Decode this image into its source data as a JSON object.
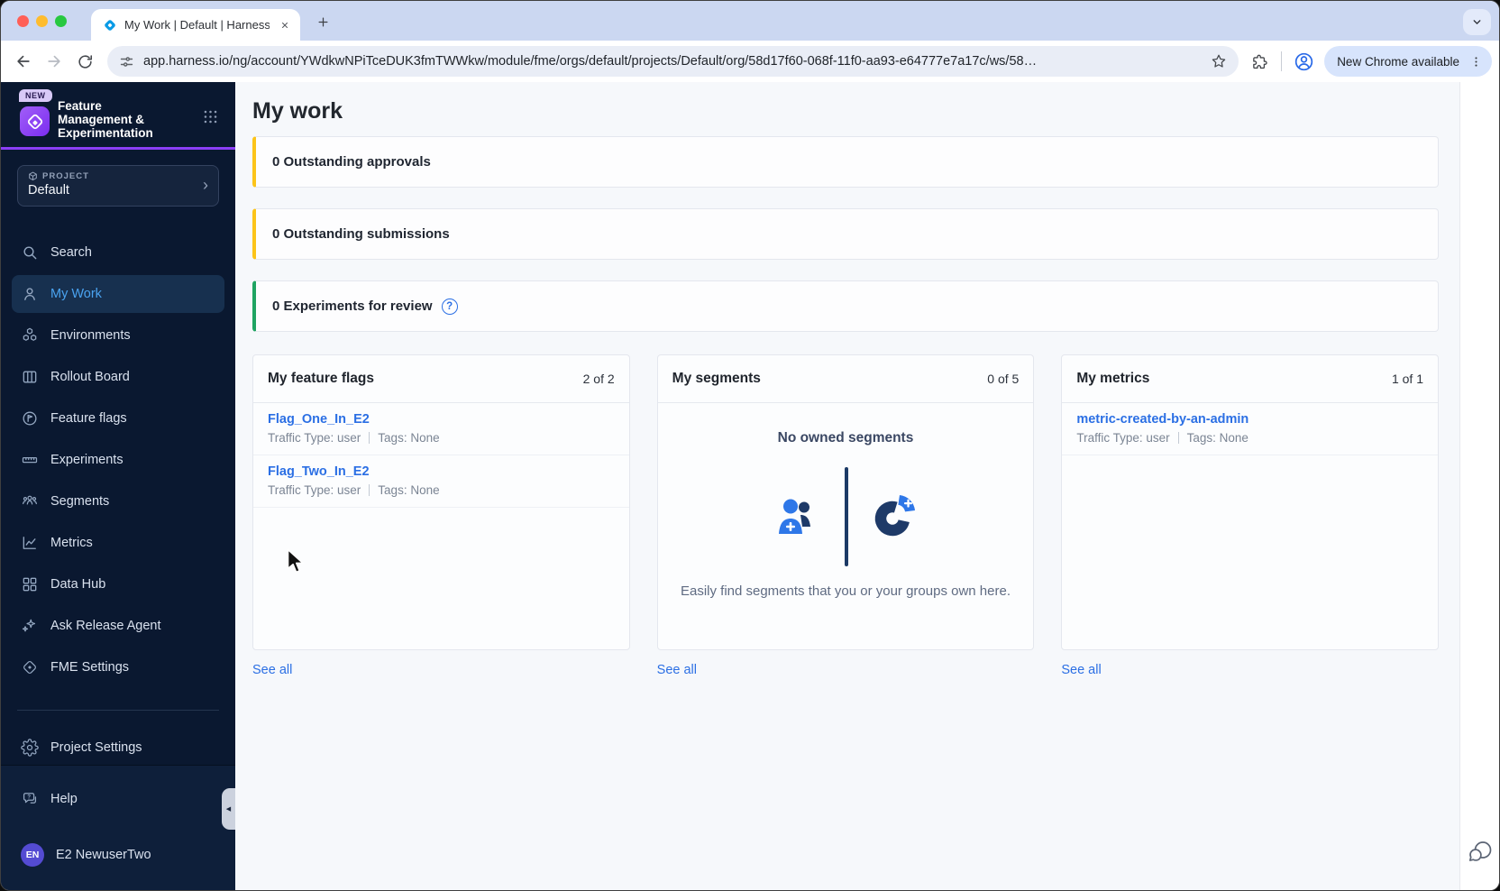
{
  "browser": {
    "tab_title": "My Work | Default | Harness",
    "url": "app.harness.io/ng/account/YWdkwNPiTceDUK3fmTWWkw/module/fme/orgs/default/projects/Default/org/58d17f60-068f-11f0-aa93-e64777e7a17c/ws/58…",
    "update_label": "New Chrome available"
  },
  "sidebar": {
    "new_badge": "NEW",
    "module_title": "Feature Management & Experimentation",
    "project": {
      "label": "PROJECT",
      "name": "Default"
    },
    "nav": [
      {
        "label": "Search",
        "icon": "search-icon",
        "active": false
      },
      {
        "label": "My Work",
        "icon": "person-icon",
        "active": true
      },
      {
        "label": "Environments",
        "icon": "hexagons-icon",
        "active": false
      },
      {
        "label": "Rollout Board",
        "icon": "board-columns-icon",
        "active": false
      },
      {
        "label": "Feature flags",
        "icon": "flag-circle-icon",
        "active": false
      },
      {
        "label": "Experiments",
        "icon": "ruler-icon",
        "active": false
      },
      {
        "label": "Segments",
        "icon": "people-icon",
        "active": false
      },
      {
        "label": "Metrics",
        "icon": "line-chart-icon",
        "active": false
      },
      {
        "label": "Data Hub",
        "icon": "grid-squares-icon",
        "active": false
      },
      {
        "label": "Ask Release Agent",
        "icon": "sparkles-icon",
        "active": false
      },
      {
        "label": "FME Settings",
        "icon": "split-logo-icon",
        "active": false
      }
    ],
    "project_settings": "Project Settings",
    "help": "Help",
    "user": {
      "initials": "EN",
      "name": "E2 NewuserTwo"
    }
  },
  "main": {
    "title": "My work",
    "banners": [
      {
        "text": "0 Outstanding approvals",
        "accent": "#fcc419",
        "has_help_icon": false
      },
      {
        "text": "0 Outstanding submissions",
        "accent": "#fcc419",
        "has_help_icon": false
      },
      {
        "text": "0 Experiments for review",
        "accent": "#1fa462",
        "has_help_icon": true
      }
    ],
    "help_icon_glyph": "?",
    "cards": {
      "flags": {
        "title": "My feature flags",
        "count": "2 of 2",
        "items": [
          {
            "name": "Flag_One_In_E2",
            "traffic": "Traffic Type: user",
            "tags": "Tags: None"
          },
          {
            "name": "Flag_Two_In_E2",
            "traffic": "Traffic Type: user",
            "tags": "Tags: None"
          }
        ],
        "see_all": "See all"
      },
      "segments": {
        "title": "My segments",
        "count": "0 of 5",
        "empty_heading": "No owned segments",
        "empty_description": "Easily find segments that you or your groups own here.",
        "see_all": "See all"
      },
      "metrics": {
        "title": "My metrics",
        "count": "1 of 1",
        "items": [
          {
            "name": "metric-created-by-an-admin",
            "traffic": "Traffic Type: user",
            "tags": "Tags: None"
          }
        ],
        "see_all": "See all"
      }
    }
  },
  "colors": {
    "accent_purple": "#8b3ff6",
    "banner_yellow": "#fcc419",
    "banner_green": "#1fa462",
    "link_blue": "#2b6fe4",
    "sidebar_bg": "#0a1830",
    "active_nav_text": "#4aa3f0",
    "tabstrip_bg": "#cbd7f1",
    "update_pill_bg": "#d7e4fc"
  }
}
